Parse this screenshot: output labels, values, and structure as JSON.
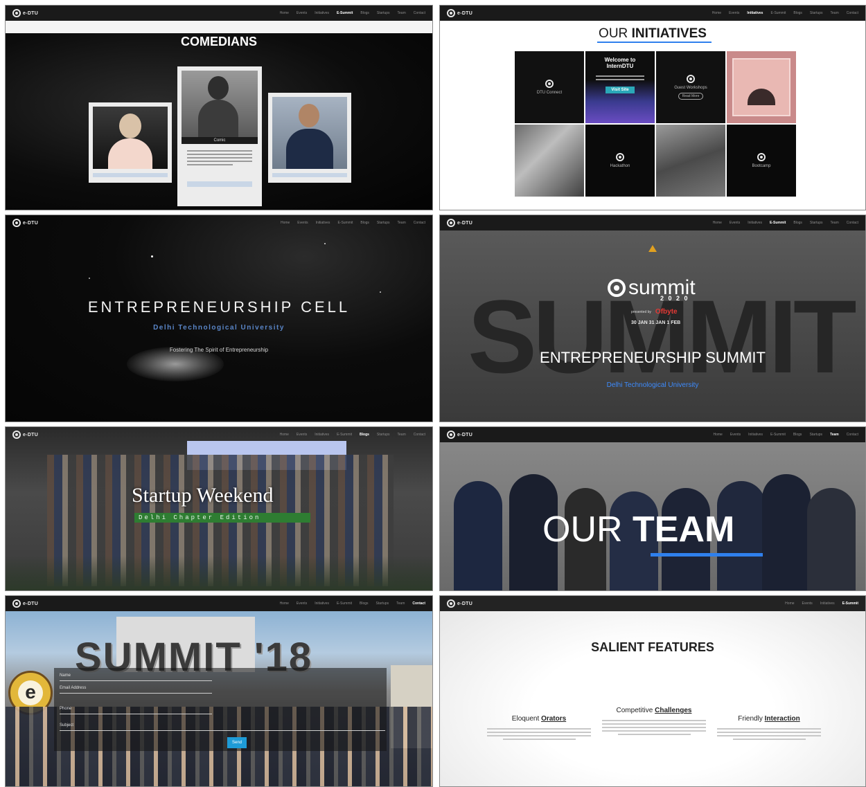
{
  "logo_text": "e-DTU",
  "nav_items": [
    "Home",
    "Events",
    "Initiatives",
    "E-Summit",
    "Blogs",
    "Startups",
    "Team",
    "Contact"
  ],
  "comedians": {
    "title": "COMEDIANS",
    "card_caption": "Comic",
    "colors": {
      "bg": "#050505",
      "card": "#ececec",
      "caption_bar": "#1b1b1b",
      "button": "#c9d6e6"
    }
  },
  "initiatives": {
    "title_plain": "OUR",
    "title_bold": "INITIATIVES",
    "tiles": [
      {
        "label": "DTU Connect",
        "kind": "logo"
      },
      {
        "label": "Welcome to InternDTU",
        "kind": "intern",
        "button": "Visit Site"
      },
      {
        "label": "Guest Workshops",
        "kind": "logo",
        "button": "Read More"
      },
      {
        "label": "",
        "kind": "pink"
      },
      {
        "label": "",
        "kind": "photo"
      },
      {
        "label": "Hackathon",
        "kind": "logo"
      },
      {
        "label": "",
        "kind": "photo"
      },
      {
        "label": "Bootcamp",
        "kind": "logo"
      }
    ],
    "colors": {
      "accent": "#2f80ed",
      "tile_dark": "#111111",
      "tile_pink": "#c98a8a"
    }
  },
  "ecell": {
    "title": "ENTREPRENEURSHIP CELL",
    "subtitle": "Delhi Technological University",
    "tagline": "Fostering The Spirit of Entrepreneurship",
    "colors": {
      "subtitle": "#5a86c8"
    }
  },
  "summit": {
    "logo_word": "summit",
    "year": "2 0 2 0",
    "presented_by": "presented by",
    "sponsor": "Ofbyte",
    "dates": "30 JAN 31 JAN 1 FEB",
    "title": "ENTREPRENEURSHIP SUMMIT",
    "subtitle": "Delhi Technological University",
    "colors": {
      "accent": "#3d8bfd",
      "sponsor": "#e53935"
    }
  },
  "startup_weekend": {
    "title": "Startup Weekend",
    "subtitle": "Delhi Chapter Edition",
    "colors": {
      "banner": "#2e7d32"
    }
  },
  "team": {
    "title_light": "OUR",
    "title_bold": "TEAM",
    "colors": {
      "underline": "#2f80ed"
    }
  },
  "summit18": {
    "title": "SUMMIT '18",
    "form_labels": [
      "Name",
      "Email Address",
      "Phone",
      "Subject"
    ],
    "submit": "Send",
    "colors": {
      "button": "#1e9bd7"
    }
  },
  "features": {
    "title": "SALIENT FEATURES",
    "items": [
      {
        "plain": "Eloquent",
        "bold": "Orators"
      },
      {
        "plain": "Competitive",
        "bold": "Challenges"
      },
      {
        "plain": "Friendly",
        "bold": "Interaction"
      }
    ]
  }
}
